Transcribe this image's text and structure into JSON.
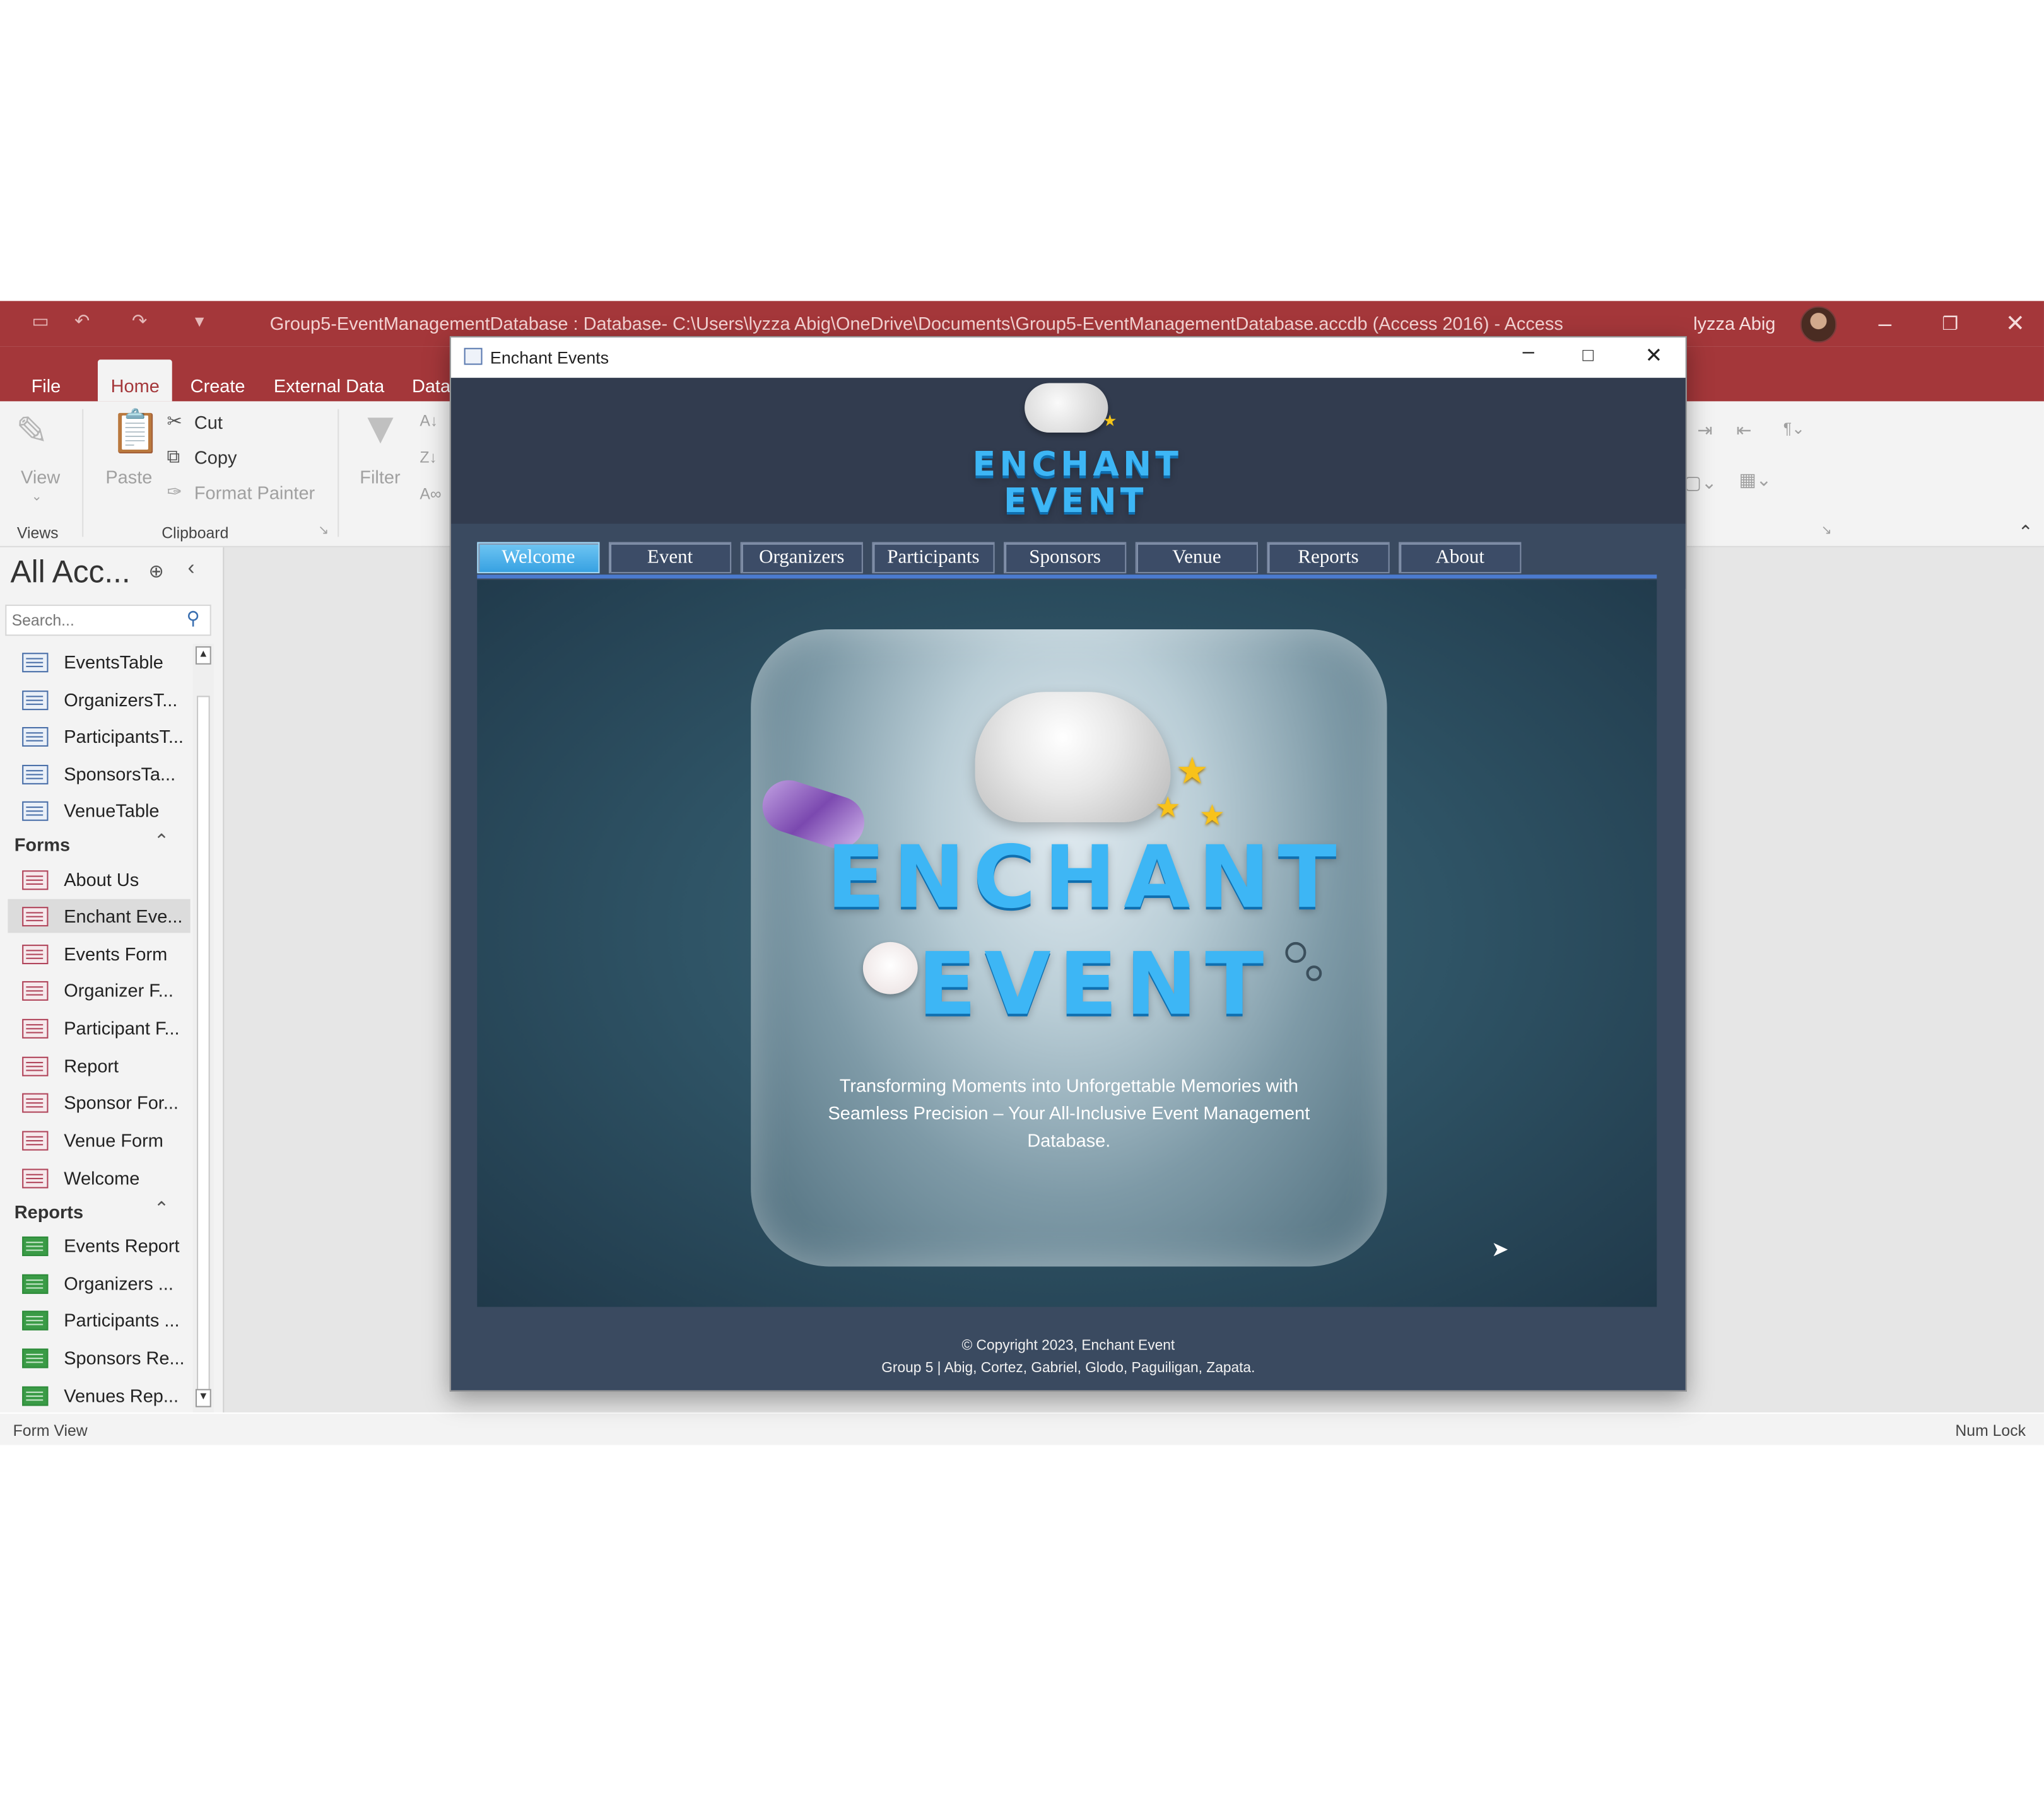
{
  "app": {
    "window_title": "Group5-EventManagementDatabase : Database- C:\\Users\\lyzza Abig\\OneDrive\\Documents\\Group5-EventManagementDatabase.accdb (Access 2016)  -  Access",
    "user_name": "lyzza Abig"
  },
  "ribbon": {
    "tabs": [
      "File",
      "Home",
      "Create",
      "External Data",
      "Data"
    ],
    "active_tab": "Home",
    "view_label": "View",
    "views_group": "Views",
    "paste_label": "Paste",
    "cut_label": "Cut",
    "copy_label": "Copy",
    "format_painter_label": "Format Painter",
    "clipboard_group": "Clipboard",
    "filter_label": "Filter"
  },
  "nav_pane": {
    "header": "All Acc...",
    "search_placeholder": "Search...",
    "tables": [
      "EventsTable",
      "OrganizersT...",
      "ParticipantsT...",
      "SponsorsTa...",
      "VenueTable"
    ],
    "forms_group": "Forms",
    "forms": [
      "About Us",
      "Enchant Eve...",
      "Events Form",
      "Organizer F...",
      "Participant F...",
      "Report",
      "Sponsor For...",
      "Venue Form",
      "Welcome"
    ],
    "selected_form": "Enchant Eve...",
    "reports_group": "Reports",
    "reports": [
      "Events Report",
      "Organizers ...",
      "Participants ...",
      "Sponsors Re...",
      "Venues Rep..."
    ]
  },
  "form": {
    "title": "Enchant Events",
    "logo_line1": "ENCHANT",
    "logo_line2": "EVENT",
    "nav_buttons": [
      "Welcome",
      "Event",
      "Organizers",
      "Participants",
      "Sponsors",
      "Venue",
      "Reports",
      "About"
    ],
    "active_button": "Welcome",
    "tagline": "Transforming Moments into Unforgettable Memories with Seamless Precision – Your All-Inclusive Event Management Database.",
    "copyright": "© Copyright 2023, Enchant Event",
    "credits": "Group 5 | Abig, Cortez, Gabriel, Glodo, Paguiligan, Zapata."
  },
  "status": {
    "left": "Form View",
    "right": "Num Lock"
  },
  "colors": {
    "access_red": "#a4373a",
    "form_bg": "#3a4a60",
    "active_button": "#37a1e2",
    "logo_blue": "#3db6f5"
  }
}
